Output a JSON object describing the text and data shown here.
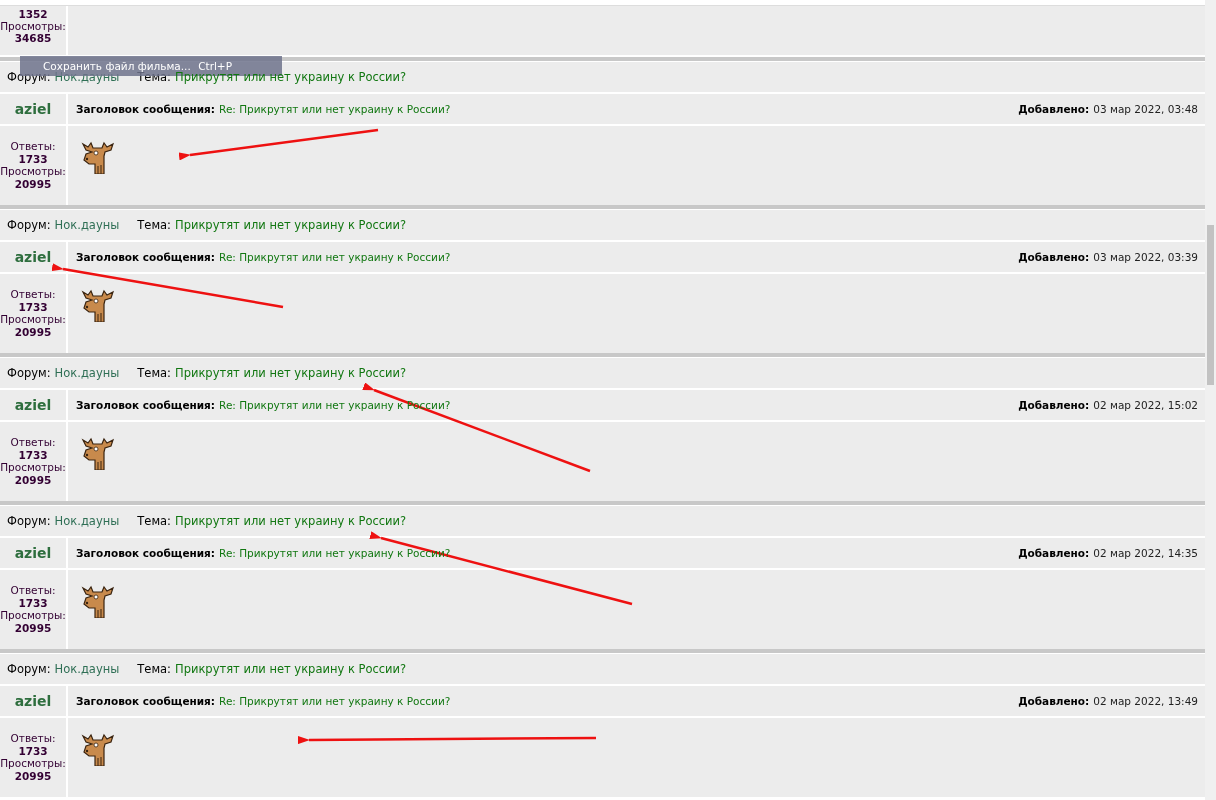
{
  "partial_post": {
    "replies_count": "1352",
    "views_label": "Просмотры:",
    "views_count": "34685"
  },
  "overlay_menu_item": {
    "label": "Сохранить файл фильма...",
    "shortcut": "Ctrl+P"
  },
  "posts": [
    {
      "forum_label": "Форум:",
      "forum": "Нок.дауны",
      "topic_label": "Тема:",
      "topic": "Прикрутят или нет украину к России?",
      "author": "aziel",
      "subject_label": "Заголовок сообщения:",
      "subject": "Re: Прикрутят или нет украину к России?",
      "added_label": "Добавлено:",
      "added": "03 мар 2022, 03:48",
      "replies_label": "Ответы:",
      "replies": "1733",
      "views_label": "Просмотры:",
      "views": "20995"
    },
    {
      "forum_label": "Форум:",
      "forum": "Нок.дауны",
      "topic_label": "Тема:",
      "topic": "Прикрутят или нет украину к России?",
      "author": "aziel",
      "subject_label": "Заголовок сообщения:",
      "subject": "Re: Прикрутят или нет украину к России?",
      "added_label": "Добавлено:",
      "added": "03 мар 2022, 03:39",
      "replies_label": "Ответы:",
      "replies": "1733",
      "views_label": "Просмотры:",
      "views": "20995"
    },
    {
      "forum_label": "Форум:",
      "forum": "Нок.дауны",
      "topic_label": "Тема:",
      "topic": "Прикрутят или нет украину к России?",
      "author": "aziel",
      "subject_label": "Заголовок сообщения:",
      "subject": "Re: Прикрутят или нет украину к России?",
      "added_label": "Добавлено:",
      "added": "02 мар 2022, 15:02",
      "replies_label": "Ответы:",
      "replies": "1733",
      "views_label": "Просмотры:",
      "views": "20995"
    },
    {
      "forum_label": "Форум:",
      "forum": "Нок.дауны",
      "topic_label": "Тема:",
      "topic": "Прикрутят или нет украину к России?",
      "author": "aziel",
      "subject_label": "Заголовок сообщения:",
      "subject": "Re: Прикрутят или нет украину к России?",
      "added_label": "Добавлено:",
      "added": "02 мар 2022, 14:35",
      "replies_label": "Ответы:",
      "replies": "1733",
      "views_label": "Просмотры:",
      "views": "20995"
    },
    {
      "forum_label": "Форум:",
      "forum": "Нок.дауны",
      "topic_label": "Тема:",
      "topic": "Прикрутят или нет украину к России?",
      "author": "aziel",
      "subject_label": "Заголовок сообщения:",
      "subject": "Re: Прикрутят или нет украину к России?",
      "added_label": "Добавлено:",
      "added": "02 мар 2022, 13:49",
      "replies_label": "Ответы:",
      "replies": "1733",
      "views_label": "Просмотры:",
      "views": "20995"
    }
  ]
}
